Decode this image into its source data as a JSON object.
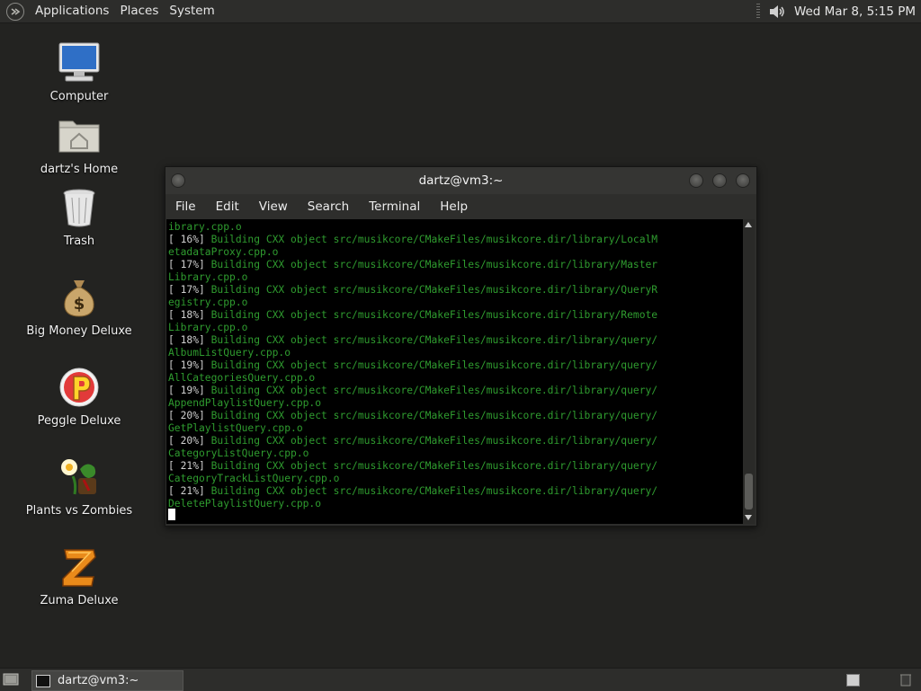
{
  "top_panel": {
    "menus": [
      "Applications",
      "Places",
      "System"
    ],
    "clock": "Wed Mar  8,  5:15 PM",
    "icons": {
      "logo": "distro-logo-icon",
      "volume": "speaker-icon"
    }
  },
  "desktop": {
    "icons": [
      {
        "label": "Computer",
        "icon": "computer-icon"
      },
      {
        "label": "dartz's Home",
        "icon": "home-folder-icon"
      },
      {
        "label": "Trash",
        "icon": "trash-icon"
      },
      {
        "label": "Big Money Deluxe",
        "icon": "money-bag-icon"
      },
      {
        "label": "Peggle Deluxe",
        "icon": "peggle-icon"
      },
      {
        "label": "Plants vs Zombies",
        "icon": "plants-vs-zombies-icon"
      },
      {
        "label": "Zuma Deluxe",
        "icon": "zuma-icon"
      }
    ]
  },
  "terminal": {
    "title": "dartz@vm3:~",
    "menu": [
      "File",
      "Edit",
      "View",
      "Search",
      "Terminal",
      "Help"
    ],
    "output": [
      "ibrary.cpp.o",
      "[ 16%] Building CXX object src/musikcore/CMakeFiles/musikcore.dir/library/LocalM",
      "etadataProxy.cpp.o",
      "[ 17%] Building CXX object src/musikcore/CMakeFiles/musikcore.dir/library/Master",
      "Library.cpp.o",
      "[ 17%] Building CXX object src/musikcore/CMakeFiles/musikcore.dir/library/QueryR",
      "egistry.cpp.o",
      "[ 18%] Building CXX object src/musikcore/CMakeFiles/musikcore.dir/library/Remote",
      "Library.cpp.o",
      "[ 18%] Building CXX object src/musikcore/CMakeFiles/musikcore.dir/library/query/",
      "AlbumListQuery.cpp.o",
      "[ 19%] Building CXX object src/musikcore/CMakeFiles/musikcore.dir/library/query/",
      "AllCategoriesQuery.cpp.o",
      "[ 19%] Building CXX object src/musikcore/CMakeFiles/musikcore.dir/library/query/",
      "AppendPlaylistQuery.cpp.o",
      "[ 20%] Building CXX object src/musikcore/CMakeFiles/musikcore.dir/library/query/",
      "GetPlaylistQuery.cpp.o",
      "[ 20%] Building CXX object src/musikcore/CMakeFiles/musikcore.dir/library/query/",
      "CategoryListQuery.cpp.o",
      "[ 21%] Building CXX object src/musikcore/CMakeFiles/musikcore.dir/library/query/",
      "CategoryTrackListQuery.cpp.o",
      "[ 21%] Building CXX object src/musikcore/CMakeFiles/musikcore.dir/library/query/",
      "DeletePlaylistQuery.cpp.o"
    ]
  },
  "bottom_panel": {
    "task_label": "dartz@vm3:~",
    "icons": {
      "show_desktop": "show-desktop-icon",
      "workspace": "workspace-switcher-icon",
      "trash": "trash-applet-icon"
    }
  },
  "colors": {
    "terminal_text": "#2f9c2f",
    "panel": "#2d2d2b",
    "desktop": "#232321"
  }
}
